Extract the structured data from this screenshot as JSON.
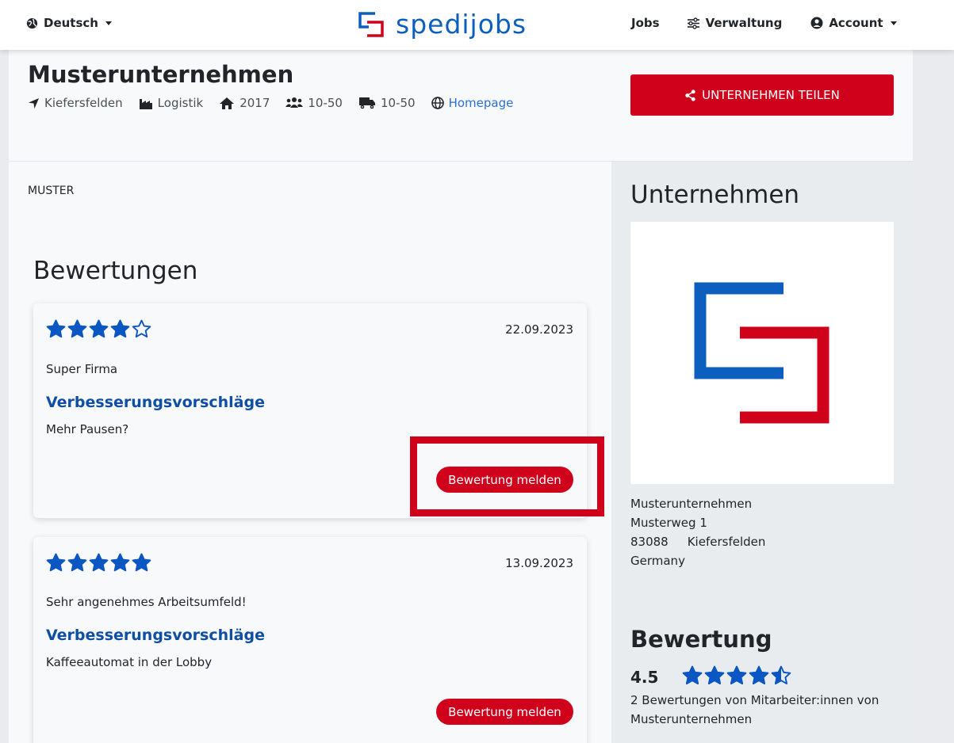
{
  "nav": {
    "language": "Deutsch",
    "logo_text": "spedijobs",
    "jobs": "Jobs",
    "verwaltung": "Verwaltung",
    "account": "Account"
  },
  "company": {
    "name": "Musterunternehmen",
    "meta": {
      "location": "Kiefersfelden",
      "industry": "Logistik",
      "founded": "2017",
      "employees": "10-50",
      "vehicles": "10-50",
      "homepage": "Homepage"
    },
    "share_label": "UNTERNEHMEN TEILEN",
    "description": "MUSTER"
  },
  "reviews": {
    "heading": "Bewertungen",
    "items": [
      {
        "stars": 4,
        "date": "22.09.2023",
        "text": "Super Firma",
        "sub_heading": "Verbesserungsvorschläge",
        "sub_text": "Mehr Pausen?",
        "report_label": "Bewertung melden"
      },
      {
        "stars": 5,
        "date": "13.09.2023",
        "text": "Sehr angenehmes Arbeitsumfeld!",
        "sub_heading": "Verbesserungsvorschläge",
        "sub_text": "Kaffeeautomat in der Lobby",
        "report_label": "Bewertung melden"
      }
    ]
  },
  "sidebar": {
    "heading": "Unternehmen",
    "address": {
      "name": "Musterunternehmen",
      "street": "Musterweg 1",
      "zip": "83088",
      "city": "Kiefersfelden",
      "country": "Germany"
    },
    "rating_heading": "Bewertung",
    "rating_value": "4.5",
    "rating_stars": 4.5,
    "rating_count": "2 Bewertungen von Mitarbeiter:innen von Musterunternehmen"
  },
  "colors": {
    "brand_red": "#d0021b",
    "brand_blue": "#0d5fbf",
    "star_blue": "#0a56c2"
  }
}
